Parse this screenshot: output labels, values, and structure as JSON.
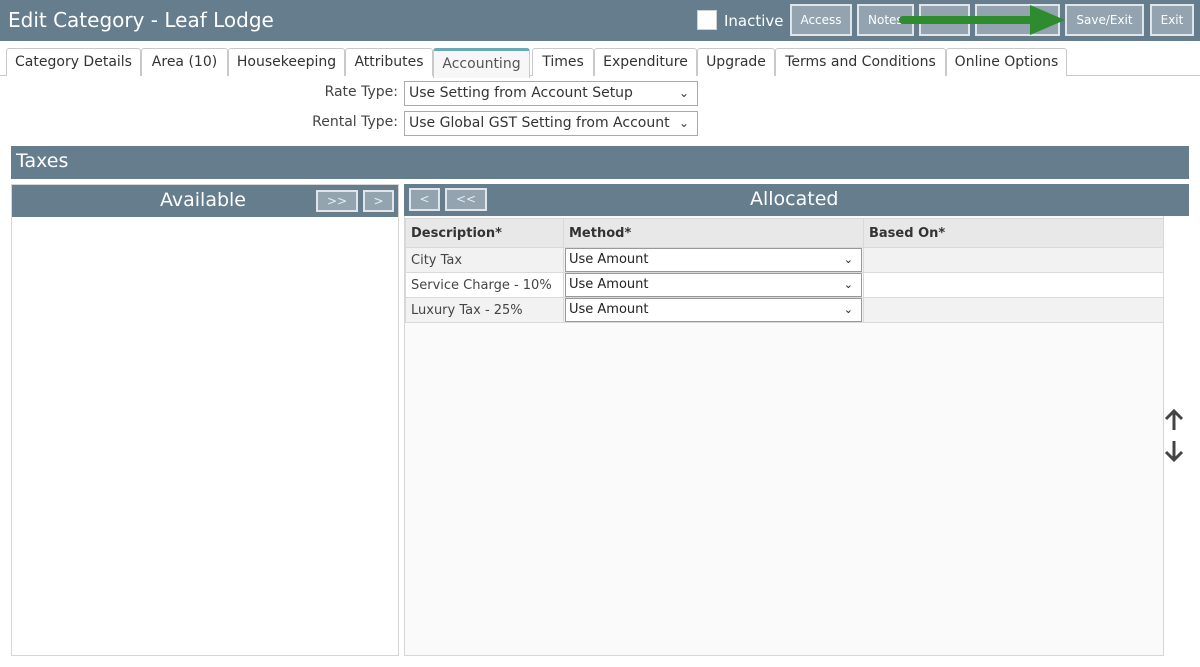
{
  "header": {
    "title": "Edit Category - Leaf Lodge",
    "inactive_label": "Inactive",
    "buttons": {
      "access": "Access",
      "notes": "Notes",
      "save_exit": "Save/Exit",
      "exit": "Exit"
    },
    "annotation_arrow_color": "#2e8b2e"
  },
  "tabs": [
    {
      "label": "Category Details"
    },
    {
      "label": "Area (10)"
    },
    {
      "label": "Housekeeping"
    },
    {
      "label": "Attributes"
    },
    {
      "label": "Accounting"
    },
    {
      "label": "Times"
    },
    {
      "label": "Expenditure"
    },
    {
      "label": "Upgrade"
    },
    {
      "label": "Terms and Conditions"
    },
    {
      "label": "Online Options"
    }
  ],
  "active_tab": "Accounting",
  "form": {
    "rate_type_label": "Rate Type:",
    "rate_type_value": "Use Setting from Account Setup",
    "rental_type_label": "Rental Type:",
    "rental_type_value": "Use Global GST Setting from Account"
  },
  "taxes": {
    "section_title": "Taxes",
    "available_title": "Available",
    "allocated_title": "Allocated",
    "move_all_right": ">>",
    "move_right": ">",
    "move_left": "<",
    "move_all_left": "<<",
    "columns": [
      "Description*",
      "Method*",
      "Based On*"
    ],
    "rows": [
      {
        "description": "City Tax",
        "method": "Use Amount",
        "based_on": ""
      },
      {
        "description": "Service Charge - 10%",
        "method": "Use Amount",
        "based_on": ""
      },
      {
        "description": "Luxury Tax - 25%",
        "method": "Use Amount",
        "based_on": ""
      }
    ]
  },
  "colors": {
    "header_bg": "#657d8d",
    "button_bg": "#93a4b0",
    "active_tab_accent": "#6aa9b5"
  },
  "icons": {
    "up": "arrow-up-icon",
    "down": "arrow-down-icon",
    "chevron": "chevron-down-icon"
  }
}
